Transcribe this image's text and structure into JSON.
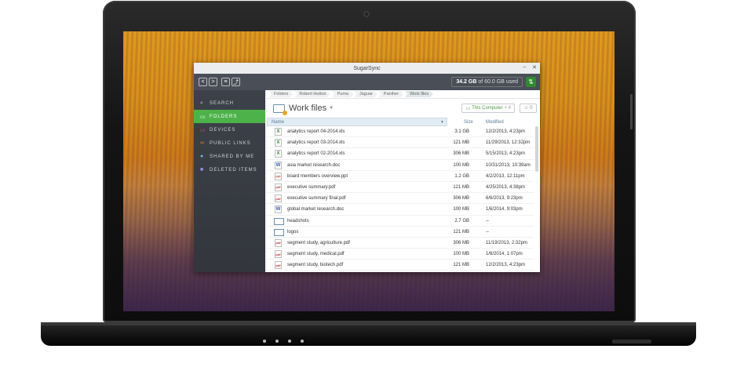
{
  "window": {
    "title": "SugarSync",
    "min": "–",
    "close": "✕"
  },
  "toolbar": {
    "back": "<",
    "forward": ">",
    "menu": "≡",
    "folder": "⤴",
    "storage_used": "34.2 GB",
    "storage_rest": "of 60.0 GB used"
  },
  "sidebar": {
    "items": [
      {
        "label": "SEARCH",
        "icon": "search-icon"
      },
      {
        "label": "FOLDERS",
        "icon": "folder-icon"
      },
      {
        "label": "DEVICES",
        "icon": "monitor-icon"
      },
      {
        "label": "PUBLIC LINKS",
        "icon": "link-icon"
      },
      {
        "label": "SHARED BY ME",
        "icon": "users-icon"
      },
      {
        "label": "DELETED ITEMS",
        "icon": "trash-icon"
      }
    ]
  },
  "breadcrumbs": [
    "Folders",
    "Robert Hutton",
    "Puma",
    "Jaguar",
    "Panther",
    "Work files"
  ],
  "folder": {
    "title": "Work files",
    "location": "This Computer",
    "location_extra": "+ 4",
    "share_count": "0"
  },
  "columns": {
    "name": "Name",
    "size": "Size",
    "modified": "Modified"
  },
  "files": [
    {
      "type": "xls",
      "name": "analytics report 04-2014.xls",
      "size": "3.1 GB",
      "modified": "12/2/2013, 4:23pm"
    },
    {
      "type": "xls",
      "name": "analytics report 03-2014.xls",
      "size": "121 MB",
      "modified": "11/29/2013, 12:32pm"
    },
    {
      "type": "xls",
      "name": "analytics report 02-2014.xls",
      "size": "306 MB",
      "modified": "5/15/2013, 4:23pm"
    },
    {
      "type": "doc",
      "name": "asia market research.doc",
      "size": "100 MB",
      "modified": "10/31/2013, 10:39am"
    },
    {
      "type": "ppt",
      "name": "board members overview.ppt",
      "size": "1.2 GB",
      "modified": "4/2/2013, 12:11pm"
    },
    {
      "type": "pdf",
      "name": "executive summary.pdf",
      "size": "121 MB",
      "modified": "4/25/2013, 4:38pm"
    },
    {
      "type": "pdf",
      "name": "executive summary final.pdf",
      "size": "306 MB",
      "modified": "6/6/2013, 9:23pm"
    },
    {
      "type": "doc",
      "name": "global market research.doc",
      "size": "100 MB",
      "modified": "1/6/2014, 9:03pm"
    },
    {
      "type": "folder",
      "name": "headshots",
      "size": "2.7 GB",
      "modified": "--"
    },
    {
      "type": "folder",
      "name": "logos",
      "size": "121 MB",
      "modified": "--"
    },
    {
      "type": "pdf",
      "name": "segment study, agriculture.pdf",
      "size": "306 MB",
      "modified": "11/19/2013, 2:32pm"
    },
    {
      "type": "pdf",
      "name": "segment study, medical.pdf",
      "size": "100 MB",
      "modified": "1/6/2014, 1:07pm"
    },
    {
      "type": "pdf",
      "name": "segment study, biotech.pdf",
      "size": "121 MB",
      "modified": "12/2/2013, 4:23pm"
    }
  ]
}
